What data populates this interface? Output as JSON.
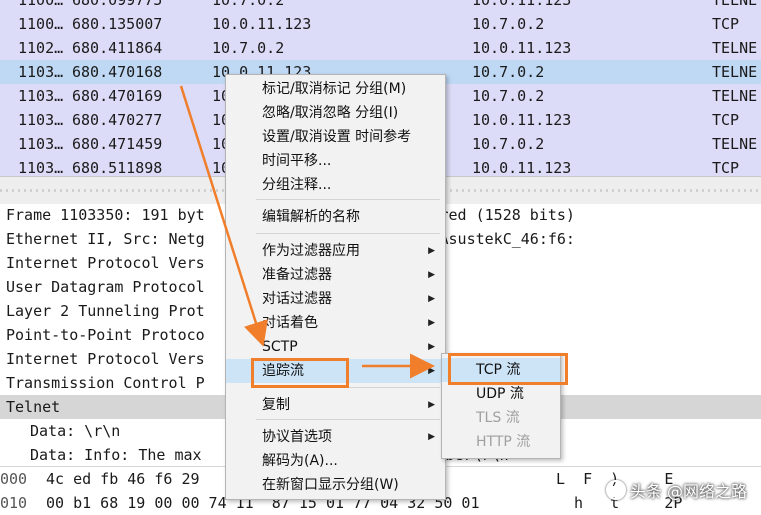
{
  "packet_list": {
    "rows": [
      {
        "no": "1100…",
        "time": "680.099775",
        "src": "10.7.0.2",
        "dst": "10.0.11.123",
        "proto": "TELNE",
        "selected": false
      },
      {
        "no": "1100…",
        "time": "680.135007",
        "src": "10.0.11.123",
        "dst": "10.7.0.2",
        "proto": "TCP",
        "selected": false
      },
      {
        "no": "1102…",
        "time": "680.411864",
        "src": "10.7.0.2",
        "dst": "10.0.11.123",
        "proto": "TELNE",
        "selected": false
      },
      {
        "no": "1103…",
        "time": "680.470168",
        "src": "10.0.11.123",
        "dst": "10.7.0.2",
        "proto": "TELNE",
        "selected": true
      },
      {
        "no": "1103…",
        "time": "680.470169",
        "src": "10",
        "dst": "10.7.0.2",
        "proto": "TELNE",
        "selected": false
      },
      {
        "no": "1103…",
        "time": "680.470277",
        "src": "10",
        "dst": "10.0.11.123",
        "proto": "TCP",
        "selected": false
      },
      {
        "no": "1103…",
        "time": "680.471459",
        "src": "10",
        "dst": "10.7.0.2",
        "proto": "TELNE",
        "selected": false
      },
      {
        "no": "1103…",
        "time": "680.511898",
        "src": "10",
        "dst": "10.0.11.123",
        "proto": "TCP",
        "selected": false
      }
    ]
  },
  "details": {
    "rows": [
      {
        "text": "Frame 1103350: 191 byt         , 191 bytes captured (1528 bits)",
        "highlight": false,
        "child": false
      },
      {
        "text": "Ethernet II, Src: Netg         :87:2f:34), Dst: AsustekC_46:f6:",
        "highlight": false,
        "child": false
      },
      {
        "text": "Internet Protocol Vers         , Dst: 80.1.1.100",
        "highlight": false,
        "child": false
      },
      {
        "text": "User Datagram Protocol          Port: 1701",
        "highlight": false,
        "child": false
      },
      {
        "text": "Layer 2 Tunneling Prot",
        "highlight": false,
        "child": false
      },
      {
        "text": "Point-to-Point Protoco",
        "highlight": false,
        "child": false
      },
      {
        "text": "Internet Protocol Vers                0.2",
        "highlight": false,
        "child": false
      },
      {
        "text": "Transmission Control P                8701, Seq: 162, Ack:",
        "highlight": false,
        "child": false
      },
      {
        "text": "Telnet",
        "highlight": true,
        "child": false
      },
      {
        "text": "Data: \\r\\n",
        "highlight": false,
        "child": true
      },
      {
        "text": "Data: Info: The max                        number\\r\\n",
        "highlight": false,
        "child": true
      }
    ]
  },
  "bytes": {
    "rows": [
      {
        "offset": "000",
        "hex": "4c ed fb 46 f6 29                00 45 00",
        "ascii": "L  F  )     E"
      },
      {
        "offset": "010",
        "hex": "00 b1 68 19 00 00 74 11  87 15 01 77 04 32 50 01",
        "ascii": "  h   t     2P"
      }
    ]
  },
  "context_menu": {
    "items": [
      {
        "label": "标记/取消标记 分组(M)",
        "submenu": false
      },
      {
        "label": "忽略/取消忽略 分组(I)",
        "submenu": false
      },
      {
        "label": "设置/取消设置 时间参考",
        "submenu": false
      },
      {
        "label": "时间平移...",
        "submenu": false
      },
      {
        "label": "分组注释...",
        "submenu": false
      },
      {
        "label": "编辑解析的名称",
        "submenu": false
      },
      {
        "label": "作为过滤器应用",
        "submenu": true
      },
      {
        "label": "准备过滤器",
        "submenu": true
      },
      {
        "label": "对话过滤器",
        "submenu": true
      },
      {
        "label": "对话着色",
        "submenu": true
      },
      {
        "label": "SCTP",
        "submenu": true
      },
      {
        "label": "追踪流",
        "submenu": true,
        "active": true
      },
      {
        "label": "复制",
        "submenu": true
      },
      {
        "label": "协议首选项",
        "submenu": true
      },
      {
        "label": "解码为(A)...",
        "submenu": false
      },
      {
        "label": "在新窗口显示分组(W)",
        "submenu": false
      }
    ]
  },
  "submenu": {
    "items": [
      {
        "label": "TCP 流",
        "enabled": true,
        "active": true
      },
      {
        "label": "UDP 流",
        "enabled": true
      },
      {
        "label": "TLS 流",
        "enabled": false
      },
      {
        "label": "HTTP 流",
        "enabled": false
      }
    ]
  },
  "icons": {
    "submenu_arrow": "triangle-right-icon"
  },
  "colors": {
    "annotation": "#f07e2b",
    "selection": "#bfd9f5",
    "packet_bg": "#dcdcf8"
  },
  "watermark": {
    "text": "头条 @网络之路"
  }
}
